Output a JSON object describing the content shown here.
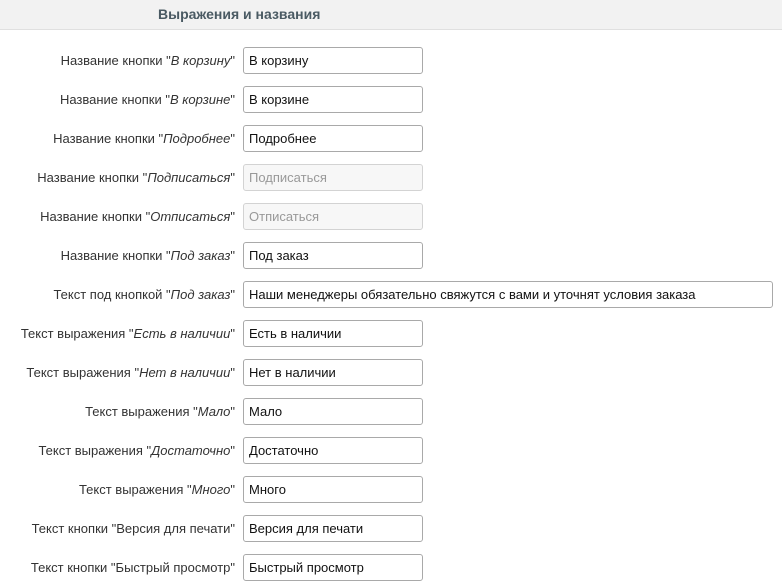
{
  "section": {
    "title": "Выражения и названия"
  },
  "rows": [
    {
      "prefix": "Название кнопки \"",
      "term": "В корзину",
      "suffix": "\"",
      "value": "В корзину",
      "disabled": false,
      "long": false
    },
    {
      "prefix": "Название кнопки \"",
      "term": "В корзине",
      "suffix": "\"",
      "value": "В корзине",
      "disabled": false,
      "long": false
    },
    {
      "prefix": "Название кнопки \"",
      "term": "Подробнее",
      "suffix": "\"",
      "value": "Подробнее",
      "disabled": false,
      "long": false
    },
    {
      "prefix": "Название кнопки \"",
      "term": "Подписаться",
      "suffix": "\"",
      "value": "Подписаться",
      "disabled": true,
      "long": false
    },
    {
      "prefix": "Название кнопки \"",
      "term": "Отписаться",
      "suffix": "\"",
      "value": "Отписаться",
      "disabled": true,
      "long": false
    },
    {
      "prefix": "Название кнопки \"",
      "term": "Под заказ",
      "suffix": "\"",
      "value": "Под заказ",
      "disabled": false,
      "long": false
    },
    {
      "prefix": "Текст под кнопкой \"",
      "term": "Под заказ",
      "suffix": "\"",
      "value": "Наши менеджеры обязательно свяжутся с вами и уточнят условия заказа",
      "disabled": false,
      "long": true
    },
    {
      "prefix": "Текст выражения \"",
      "term": "Есть в наличии",
      "suffix": "\"",
      "value": "Есть в наличии",
      "disabled": false,
      "long": false
    },
    {
      "prefix": "Текст выражения \"",
      "term": "Нет в наличии",
      "suffix": "\"",
      "value": "Нет в наличии",
      "disabled": false,
      "long": false
    },
    {
      "prefix": "Текст выражения \"",
      "term": "Мало",
      "suffix": "\"",
      "value": "Мало",
      "disabled": false,
      "long": false
    },
    {
      "prefix": "Текст выражения \"",
      "term": "Достаточно",
      "suffix": "\"",
      "value": "Достаточно",
      "disabled": false,
      "long": false
    },
    {
      "prefix": "Текст выражения \"",
      "term": "Много",
      "suffix": "\"",
      "value": "Много",
      "disabled": false,
      "long": false
    },
    {
      "prefix": "Текст кнопки \"Версия для печати\"",
      "term": "",
      "suffix": "",
      "value": "Версия для печати",
      "disabled": false,
      "long": false
    },
    {
      "prefix": "Текст кнопки \"Быстрый просмотр\"",
      "term": "",
      "suffix": "",
      "value": "Быстрый просмотр",
      "disabled": false,
      "long": false
    }
  ]
}
